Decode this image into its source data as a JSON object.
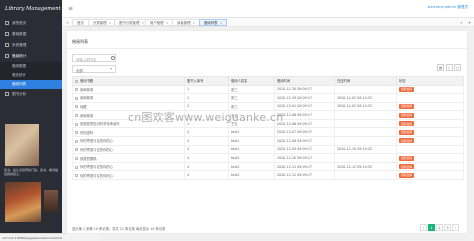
{
  "app": {
    "logo_text": "Library Management",
    "welcome_text": "welcome,admin 管理员",
    "menu_glyph": "≡"
  },
  "sidebar": {
    "items": [
      {
        "label": "我的首页",
        "icon": "home-icon"
      },
      {
        "label": "基础数据",
        "icon": "grid-icon"
      },
      {
        "label": "系统管理",
        "icon": "gear-icon"
      },
      {
        "label": "借阅统计",
        "icon": "book-icon",
        "open": true
      },
      {
        "label": "图书分析",
        "icon": "chart-icon"
      }
    ],
    "subitems": [
      {
        "label": "借阅数据"
      },
      {
        "label": "借还统计"
      },
      {
        "label": "借阅列表",
        "active": true
      }
    ],
    "photo_caption": "读书，是认识世界的门窗。读书，看清楚自我的镜子，"
  },
  "status_url": "127.0.0.1:8080/pages/book/borrow.html",
  "tabs": [
    {
      "label": "首页"
    },
    {
      "label": "分类管理"
    },
    {
      "label": "图书分类管理"
    },
    {
      "label": "用户管理"
    },
    {
      "label": "读者管理"
    },
    {
      "label": "借阅列表",
      "active": true
    }
  ],
  "panel": {
    "title": "借阅列表",
    "search_placeholder": "请输入图书名",
    "filter_value": "全部"
  },
  "table": {
    "headers": [
      "借阅书籍",
      "图书入库号",
      "借阅人姓名",
      "借阅时间",
      "归还时间",
      "状态"
    ],
    "rows": [
      {
        "book": "我和故事",
        "no": "1",
        "name": "张三",
        "borrow": "2020-11-30 09:09:17",
        "return": "",
        "status": "借阅出库"
      },
      {
        "book": "我和故事",
        "no": "1",
        "name": "张三",
        "borrow": "2020-11-29 09:09:17",
        "return": "2020-12-02 09:14:52",
        "status": ""
      },
      {
        "book": "地藏",
        "no": "2",
        "name": "张三",
        "borrow": "2020-12-01 09:09:17",
        "return": "2020-12-02 09:14:52",
        "status": "借阅出库"
      },
      {
        "book": "我和故事",
        "no": "1",
        "name": "王五",
        "borrow": "2020-12-06 09:09:17",
        "return": "",
        "status": "借阅出库"
      },
      {
        "book": "张德蒙的知识科学传承读作",
        "no": "1",
        "name": "王五",
        "borrow": "2020-12-06 09:09:17",
        "return": "",
        "status": "借阅出库"
      },
      {
        "book": "你知道吗",
        "no": "2",
        "name": "test1",
        "borrow": "2020-12-07 09:09:17",
        "return": "",
        "status": "借阅出库"
      },
      {
        "book": "你的寄语与往的你的心",
        "no": "4",
        "name": "test1",
        "borrow": "2020-12-08 09:09:17",
        "return": "",
        "status": "借阅出库"
      },
      {
        "book": "你的寄语与往的你的心",
        "no": "4",
        "name": "test1",
        "borrow": "2020-12-09 09:09:17",
        "return": "2020-12-10 09:14:52",
        "status": ""
      },
      {
        "book": "寂寞的鹦鹉",
        "no": "4",
        "name": "test2",
        "borrow": "2020-12-10 09:09:17",
        "return": "",
        "status": "借阅出库"
      },
      {
        "book": "你的寄语与往的你的心",
        "no": "4",
        "name": "test2",
        "borrow": "2020-12-11 09:09:17",
        "return": "2020-12-12 09:14:52",
        "status": "借阅出库"
      },
      {
        "book": "你的寄语与往的你的心",
        "no": "4",
        "name": "test2",
        "borrow": "2020-12-12 09:09:17",
        "return": "",
        "status": "借阅出库"
      }
    ]
  },
  "pagination": {
    "summary": "显示第 1 到第 10 条记录，总共 21 条记录  每页显示 10 条记录",
    "prev": "‹",
    "pages": [
      "1",
      "2",
      "3"
    ],
    "next": "›",
    "active_page": "1"
  },
  "watermark": "cn图欢客www.weiguanke.cn",
  "colors": {
    "sidebar_bg": "#2b2d36",
    "accent": "#2f7fe0",
    "status": "#f06a3c",
    "page_active": "#16b777"
  }
}
